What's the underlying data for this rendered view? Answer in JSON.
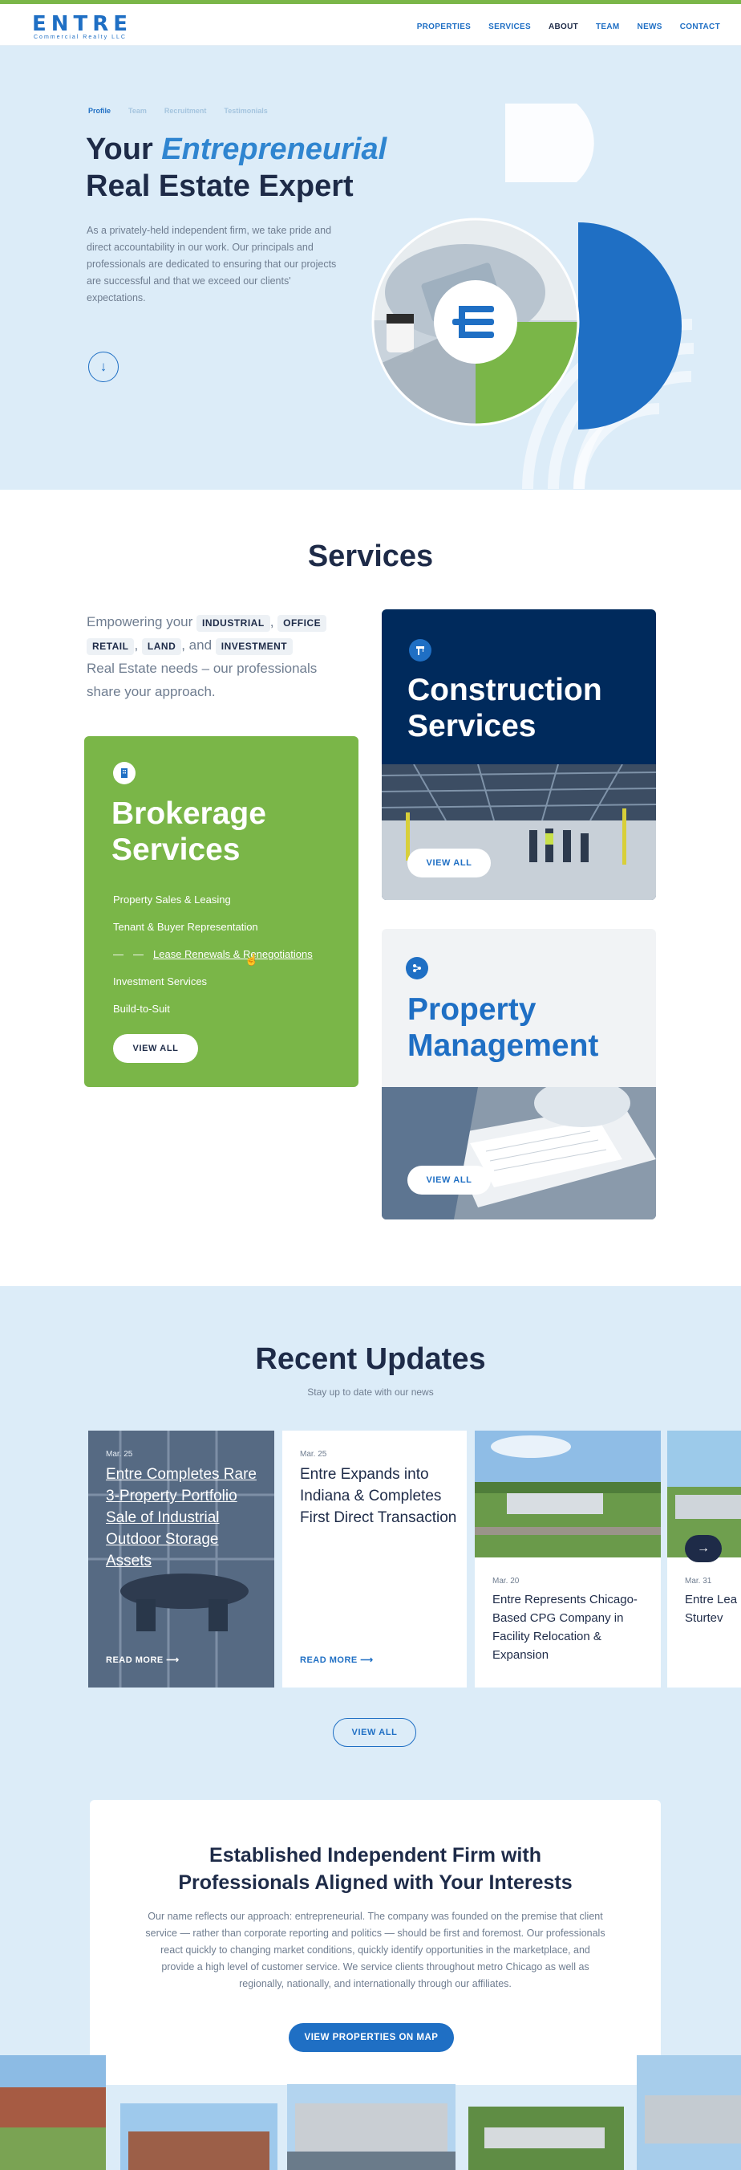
{
  "brand": {
    "logo_word": "ENTRE",
    "logo_sub": "Commercial Realty LLC"
  },
  "nav": {
    "items": [
      "PROPERTIES",
      "SERVICES",
      "ABOUT",
      "TEAM",
      "NEWS",
      "CONTACT"
    ],
    "active": "ABOUT"
  },
  "hero": {
    "tabs": [
      "Profile",
      "Team",
      "Recruitment",
      "Testimonials"
    ],
    "title_line1_prefix": "Your ",
    "title_line1_accent": "Entrepreneurial",
    "title_line2": "Real Estate Expert",
    "description": "As a privately-held independent firm, we take pride and direct accountability in our work. Our principals and professionals are dedicated to ensuring that our projects are successful and that we exceed our clients' expectations.",
    "down_arrow": "↓"
  },
  "services": {
    "title": "Services",
    "intro_before": "Empowering your",
    "chips": [
      "INDUSTRIAL",
      "OFFICE",
      "RETAIL",
      "LAND",
      "INVESTMENT"
    ],
    "intro_and": ", and",
    "intro_after": "Real Estate needs – our professionals share your approach.",
    "brokerage": {
      "title_line1": "Brokerage",
      "title_line2": "Services",
      "items": [
        "Property Sales & Leasing",
        "Tenant & Buyer Representation",
        "Lease Renewals & Renegotiations",
        "Investment Services",
        "Build-to-Suit"
      ],
      "button": "VIEW ALL"
    },
    "construction": {
      "title_line1": "Construction",
      "title_line2": "Services",
      "button": "VIEW ALL"
    },
    "property_management": {
      "title_line1": "Property",
      "title_line2": "Management",
      "button": "VIEW ALL"
    }
  },
  "updates": {
    "title": "Recent Updates",
    "subtitle": "Stay up to date with our news",
    "cards": [
      {
        "date": "Mar. 25",
        "title": "Entre Completes Rare 3-Property Portfolio Sale of Industrial Outdoor Storage Assets",
        "cta": "READ MORE"
      },
      {
        "date": "Mar. 25",
        "title": "Entre Expands into Indiana & Completes First Direct Transaction",
        "cta": "READ MORE"
      },
      {
        "date": "Mar. 20",
        "title": "Entre Represents Chicago-Based CPG Company in Facility Relocation & Expansion"
      },
      {
        "date": "Mar. 31",
        "title": "Entre Lea in Sturtev"
      }
    ],
    "view_all": "VIEW ALL"
  },
  "firm": {
    "title_line1": "Established Independent Firm with",
    "title_line2": "Professionals Aligned with Your Interests",
    "text": "Our name reflects our approach: entrepreneurial. The company was founded on the premise that client service — rather than corporate reporting and politics — should be first and foremost. Our professionals react quickly to changing market conditions, quickly identify opportunities in the marketplace, and provide a high level of customer service. We service clients throughout metro Chicago as well as regionally, nationally, and internationally through our affiliates.",
    "button": "VIEW PROPERTIES ON MAP"
  },
  "colors": {
    "brand_blue": "#1f6fc4",
    "navy": "#1e2b48",
    "green": "#7ab648",
    "light_blue": "#dcecf8",
    "dark_navy": "#002a5c"
  }
}
